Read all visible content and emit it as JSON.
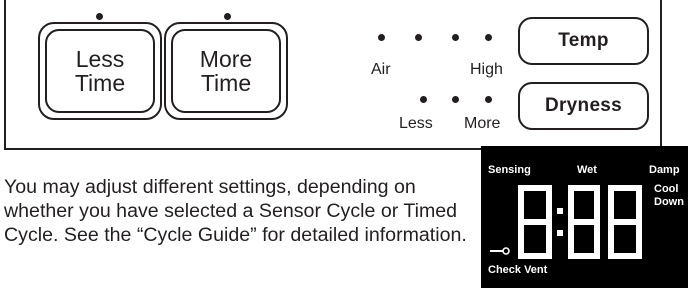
{
  "controls": {
    "less_time_label": "Less\nTime",
    "more_time_label": "More\nTime",
    "temp_label": "Temp",
    "dryness_label": "Dryness",
    "temp_levels": {
      "low": "Air",
      "high": "High"
    },
    "dryness_levels": {
      "low": "Less",
      "high": "More"
    }
  },
  "info_text": "You may adjust different settings, depending on whether you have selected a Sensor Cycle or Timed Cycle. See the “Cycle Guide” for detailed information.",
  "display": {
    "sensing": "Sensing",
    "wet": "Wet",
    "damp": "Damp",
    "cool": "Cool",
    "down": "Down",
    "check_vent": "Check Vent",
    "digits": "8:88"
  },
  "colors": {
    "ink": "#231f20",
    "display_bg": "#000000",
    "display_fg": "#ffffff"
  },
  "icons": {
    "filter": "key-filter-icon"
  }
}
